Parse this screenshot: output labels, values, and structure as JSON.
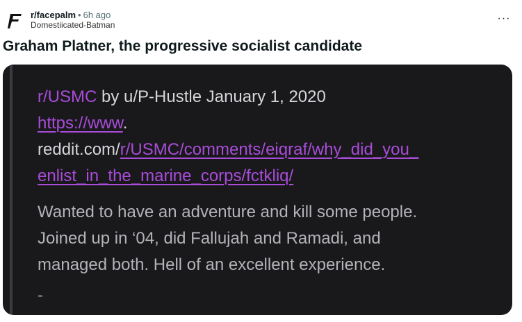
{
  "post": {
    "subreddit": "r/facepalm",
    "separator": "•",
    "time": "6h ago",
    "author": "Domestiicated-Batman",
    "more_label": "···",
    "title": "Graham Platner, the progressive socialist candidate"
  },
  "icons": {
    "subreddit_icon": "facepalm-letter-f-icon",
    "more_icon": "ellipsis-icon"
  },
  "screenshot": {
    "sub_link": "r/USMC",
    "byline": " by u/P-Hustle January 1, 2020",
    "url_part1": "https://www",
    "url_part1_suffix": ".",
    "url_part2_prefix": "reddit.com/",
    "url_part2_link": "r/USMC/comments/eiqraf/why_did_you_",
    "url_part3_link": "enlist_in_the_marine_corps/fctkliq/",
    "body_line1": "Wanted to have an adventure and kill some people.",
    "body_line2": "Joined up in ‘04, did Fallujah and Ramadi, and",
    "body_line3": "managed both. Hell of an excellent experience.",
    "trailing": "-"
  },
  "colors": {
    "card_bg": "#19191c",
    "link_purple": "#a94cd9",
    "title_text": "#0f1a1c"
  }
}
